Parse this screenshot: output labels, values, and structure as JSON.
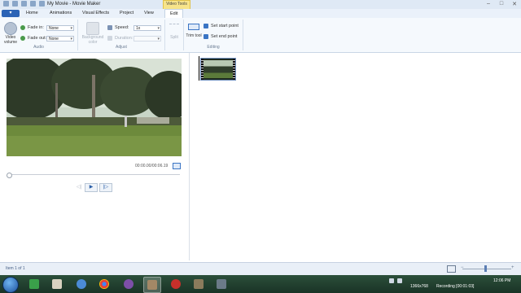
{
  "window": {
    "title": "My Movie - Movie Maker",
    "context_tab": "Video Tools"
  },
  "tabs": {
    "file": "▾",
    "items": [
      "Home",
      "Animations",
      "Visual Effects",
      "Project",
      "View",
      "Edit"
    ],
    "active": "Edit"
  },
  "ribbon": {
    "video_volume": "Video volume",
    "fade_in_label": "Fade in:",
    "fade_in_value": "None",
    "fade_out_label": "Fade out:",
    "fade_out_value": "None",
    "audio_group": "Audio",
    "background_color": "Background color",
    "speed_label": "Speed:",
    "speed_value": "1x",
    "duration_label": "Duration:",
    "adjust_group": "Adjust",
    "split": "Split",
    "trim_tool": "Trim tool",
    "set_start_point": "Set start point",
    "set_end_point": "Set end point",
    "editing_group": "Editing"
  },
  "preview": {
    "timecode": "00:00.00/00:06.19",
    "playback_position": 0
  },
  "storyboard": {
    "clip_count": 1
  },
  "status": {
    "items_text": "Item 1 of 1"
  },
  "taskbar": {
    "resolution": "1366x768",
    "recording": "Recording [00:01:03]",
    "clock": "12:06 PM"
  },
  "colors": {
    "file_button": "#2b63b6",
    "context_tab": "#f7e48a",
    "taskbar": "#2b4f3a"
  }
}
